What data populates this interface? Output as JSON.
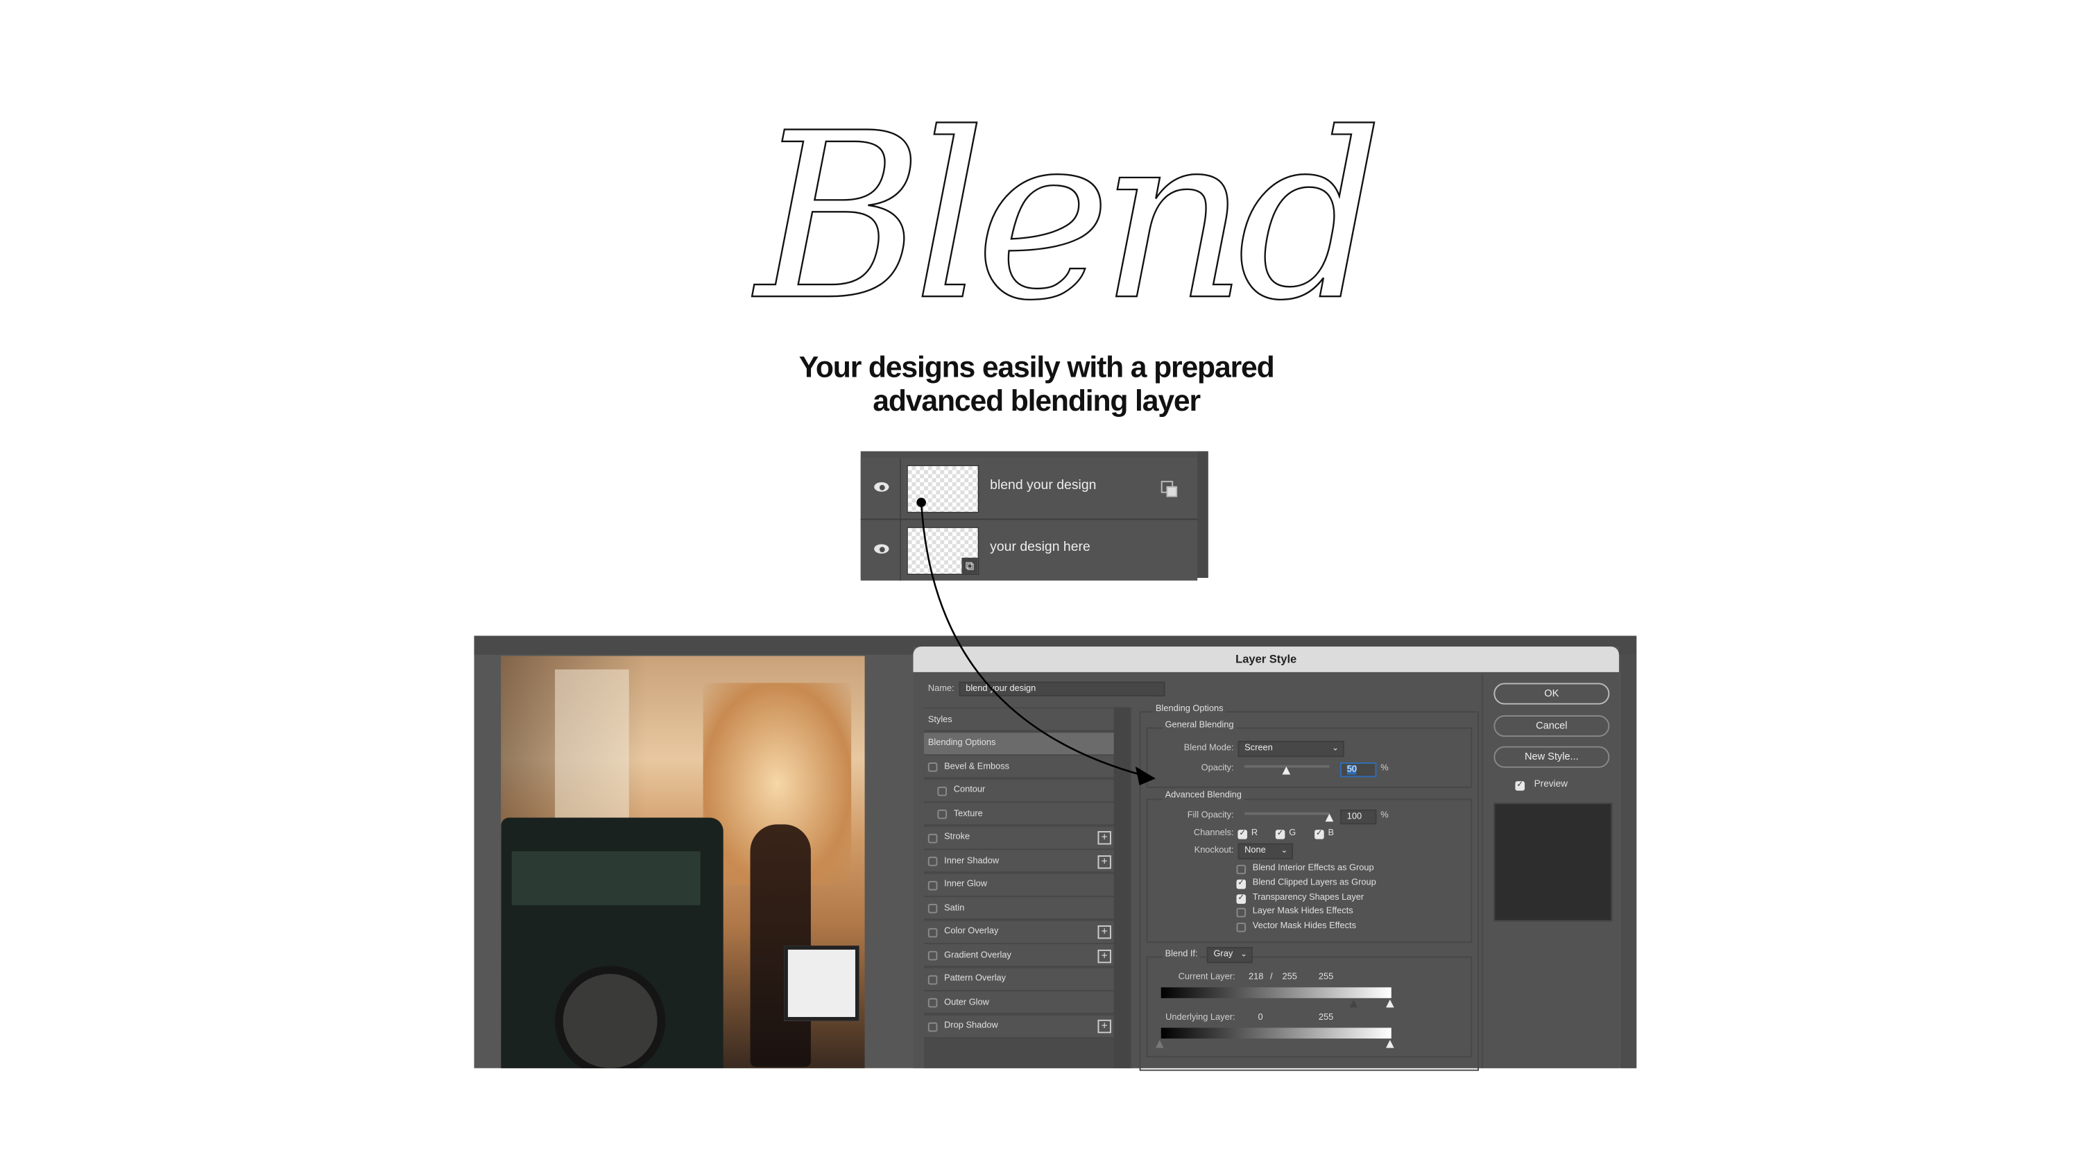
{
  "hero": {
    "script_title": "Blend",
    "headline_line1": "Your designs easily with a prepared",
    "headline_line2": "advanced blending layer"
  },
  "layers_panel": {
    "layers": [
      {
        "name": "blend your design",
        "visible": true,
        "icon": "linked-layers-icon"
      },
      {
        "name": "your design here",
        "visible": true,
        "icon": "smart-object-icon"
      }
    ]
  },
  "layer_style_dialog": {
    "title": "Layer Style",
    "name_label": "Name:",
    "name_value": "blend your design",
    "styles_list": [
      {
        "label": "Styles",
        "checkbox": false,
        "selected": false,
        "plus": false,
        "indent": false
      },
      {
        "label": "Blending Options",
        "checkbox": false,
        "selected": true,
        "plus": false,
        "indent": false
      },
      {
        "label": "Bevel & Emboss",
        "checkbox": true,
        "plus": false,
        "indent": false
      },
      {
        "label": "Contour",
        "checkbox": true,
        "plus": false,
        "indent": true
      },
      {
        "label": "Texture",
        "checkbox": true,
        "plus": false,
        "indent": true
      },
      {
        "label": "Stroke",
        "checkbox": true,
        "plus": true,
        "indent": false
      },
      {
        "label": "Inner Shadow",
        "checkbox": true,
        "plus": true,
        "indent": false
      },
      {
        "label": "Inner Glow",
        "checkbox": true,
        "plus": false,
        "indent": false
      },
      {
        "label": "Satin",
        "checkbox": true,
        "plus": false,
        "indent": false
      },
      {
        "label": "Color Overlay",
        "checkbox": true,
        "plus": true,
        "indent": false
      },
      {
        "label": "Gradient Overlay",
        "checkbox": true,
        "plus": true,
        "indent": false
      },
      {
        "label": "Pattern Overlay",
        "checkbox": true,
        "plus": false,
        "indent": false
      },
      {
        "label": "Outer Glow",
        "checkbox": true,
        "plus": false,
        "indent": false
      },
      {
        "label": "Drop Shadow",
        "checkbox": true,
        "plus": true,
        "indent": false
      }
    ],
    "blending_options": {
      "section_label": "Blending Options",
      "general_label": "General Blending",
      "blend_mode_label": "Blend Mode:",
      "blend_mode_value": "Screen",
      "opacity_label": "Opacity:",
      "opacity_value": "50",
      "percent": "%",
      "advanced_label": "Advanced Blending",
      "fill_opacity_label": "Fill Opacity:",
      "fill_opacity_value": "100",
      "channels_label": "Channels:",
      "channels": [
        {
          "label": "R",
          "checked": true
        },
        {
          "label": "G",
          "checked": true
        },
        {
          "label": "B",
          "checked": true
        }
      ],
      "knockout_label": "Knockout:",
      "knockout_value": "None",
      "options": [
        {
          "label": "Blend Interior Effects as Group",
          "checked": false
        },
        {
          "label": "Blend Clipped Layers as Group",
          "checked": true
        },
        {
          "label": "Transparency Shapes Layer",
          "checked": true
        },
        {
          "label": "Layer Mask Hides Effects",
          "checked": false
        },
        {
          "label": "Vector Mask Hides Effects",
          "checked": false
        }
      ],
      "blend_if_label": "Blend If:",
      "blend_if_value": "Gray",
      "current_layer_label": "Current Layer:",
      "current_layer_values": [
        "218",
        "/",
        "255",
        "255"
      ],
      "underlying_layer_label": "Underlying Layer:",
      "underlying_layer_values": [
        "0",
        "255"
      ]
    },
    "buttons": {
      "ok": "OK",
      "cancel": "Cancel",
      "new_style": "New Style..."
    },
    "preview_label": "Preview",
    "preview_checked": true
  },
  "colors": {
    "panel": "#535353",
    "highlight": "#2f6db5",
    "title_bar": "#dcdcdc"
  }
}
